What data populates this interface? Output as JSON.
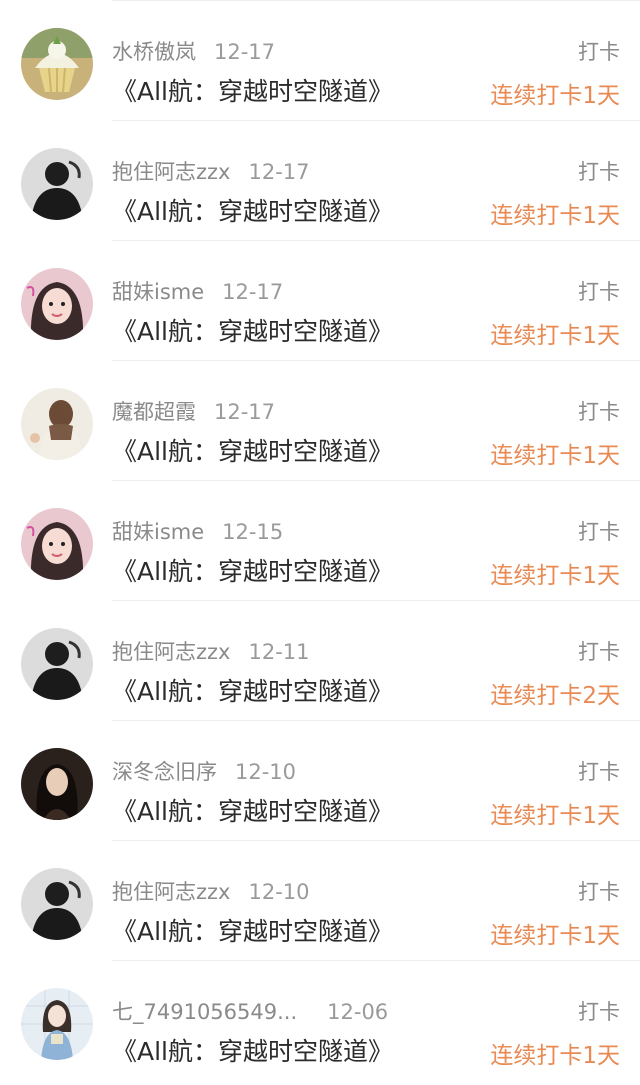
{
  "items": [
    {
      "user": "水桥傲岚",
      "date": "12-17",
      "tag": "打卡",
      "title": "《All航：穿越时空隧道》",
      "streak": "连续打卡1天",
      "avatar": "cupcake-avatar"
    },
    {
      "user": "抱住阿志zzx",
      "date": "12-17",
      "tag": "打卡",
      "title": "《All航：穿越时空隧道》",
      "streak": "连续打卡1天",
      "avatar": "dark-person-avatar"
    },
    {
      "user": "甜妹isme",
      "date": "12-17",
      "tag": "打卡",
      "title": "《All航：穿越时空隧道》",
      "streak": "连续打卡1天",
      "avatar": "girl-selfie-avatar"
    },
    {
      "user": "魔都超霞",
      "date": "12-17",
      "tag": "打卡",
      "title": "《All航：穿越时空隧道》",
      "streak": "连续打卡1天",
      "avatar": "girl-back-avatar"
    },
    {
      "user": "甜妹isme",
      "date": "12-15",
      "tag": "打卡",
      "title": "《All航：穿越时空隧道》",
      "streak": "连续打卡1天",
      "avatar": "girl-selfie-avatar"
    },
    {
      "user": "抱住阿志zzx",
      "date": "12-11",
      "tag": "打卡",
      "title": "《All航：穿越时空隧道》",
      "streak": "连续打卡2天",
      "avatar": "dark-person-avatar"
    },
    {
      "user": "深冬念旧序",
      "date": "12-10",
      "tag": "打卡",
      "title": "《All航：穿越时空隧道》",
      "streak": "连续打卡1天",
      "avatar": "dark-portrait-avatar"
    },
    {
      "user": "抱住阿志zzx",
      "date": "12-10",
      "tag": "打卡",
      "title": "《All航：穿越时空隧道》",
      "streak": "连续打卡1天",
      "avatar": "dark-person-avatar"
    },
    {
      "user": "七_7491056549...",
      "date": "12-06",
      "tag": "打卡",
      "title": "《All航：穿越时空隧道》",
      "streak": "连续打卡1天",
      "avatar": "anime-girl-avatar"
    }
  ],
  "colors": {
    "accent": "#e98a53",
    "muted": "#8a8a8a",
    "title": "#2b2b2b",
    "divider": "#eeeeee"
  }
}
